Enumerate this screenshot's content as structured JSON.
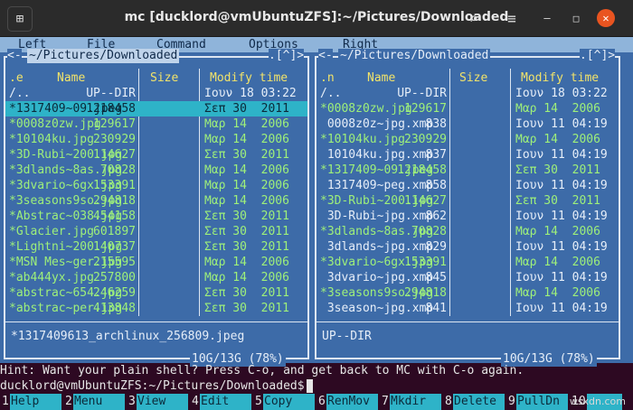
{
  "window": {
    "title": "mc [ducklord@vmUbuntuZFS]:~/Pictures/Downloaded",
    "controls": {
      "new_tab_icon": "⊞",
      "search_icon": "⌕",
      "menu_icon": "≡",
      "minimize": "–",
      "maximize": "□",
      "close": "✕"
    }
  },
  "menubar": [
    "Left",
    "File",
    "Command",
    "Options",
    "Right"
  ],
  "left_panel": {
    "title": "~/Pictures/Downloaded",
    "nav": ".[^]>",
    "nav_left": "<-",
    "headers": {
      "name_marker": ".e",
      "name": "Name",
      "size": "Size",
      "modify": "Modify time"
    },
    "rows": [
      {
        "name": "/..",
        "size": "UP--DIR",
        "date": "Ιουν 18 03:22",
        "exe": false,
        "selected": false
      },
      {
        "name": "*1317409~09.jpeg",
        "size": "1218458",
        "date": "Σεπ 30  2011",
        "exe": true,
        "selected": true
      },
      {
        "name": "*0008z0zw.jpg",
        "size": "129617",
        "date": "Μαρ 14  2006",
        "exe": true,
        "selected": false
      },
      {
        "name": "*10104ku.jpg",
        "size": "230929",
        "date": "Μαρ 14  2006",
        "exe": true,
        "selected": false
      },
      {
        "name": "*3D-Rubi~200.jpg",
        "size": "114627",
        "date": "Σεπ 30  2011",
        "exe": true,
        "selected": false
      },
      {
        "name": "*3dlands~8as.jpg",
        "size": "70828",
        "date": "Μαρ 14  2006",
        "exe": true,
        "selected": false
      },
      {
        "name": "*3dvario~6gx.jpg",
        "size": "153391",
        "date": "Μαρ 14  2006",
        "exe": true,
        "selected": false
      },
      {
        "name": "*3seasons9so.jpg",
        "size": "294818",
        "date": "Μαρ 14  2006",
        "exe": true,
        "selected": false
      },
      {
        "name": "*Abstrac~038.jpg",
        "size": "454158",
        "date": "Σεπ 30  2011",
        "exe": true,
        "selected": false
      },
      {
        "name": "*Glacier.jpg",
        "size": "601897",
        "date": "Σεπ 30  2011",
        "exe": true,
        "selected": false
      },
      {
        "name": "*Lightni~200.jpg",
        "size": "140737",
        "date": "Σεπ 30  2011",
        "exe": true,
        "selected": false
      },
      {
        "name": "*MSN Mes~ger.jpg",
        "size": "215595",
        "date": "Μαρ 14  2006",
        "exe": true,
        "selected": false
      },
      {
        "name": "*ab444yx.jpg",
        "size": "257800",
        "date": "Μαρ 14  2006",
        "exe": true,
        "selected": false
      },
      {
        "name": "*abstrac~654.jpg",
        "size": "246259",
        "date": "Σεπ 30  2011",
        "exe": true,
        "selected": false
      },
      {
        "name": "*abstrac~per.jpg",
        "size": "413848",
        "date": "Σεπ 30  2011",
        "exe": true,
        "selected": false
      }
    ],
    "status": "*1317409613_archlinux_256809.jpeg",
    "usage": "10G/13G (78%)"
  },
  "right_panel": {
    "title": "~/Pictures/Downloaded",
    "nav": ".[^]>",
    "nav_left": "<-",
    "headers": {
      "name_marker": ".n",
      "name": "Name",
      "size": "Size",
      "modify": "Modify time"
    },
    "rows": [
      {
        "name": "/..",
        "size": "UP--DIR",
        "date": "Ιουν 18 03:22",
        "exe": false
      },
      {
        "name": "*0008z0zw.jpg",
        "size": "129617",
        "date": "Μαρ 14  2006",
        "exe": true
      },
      {
        "name": " 0008z0z~jpg.xmp",
        "size": "838",
        "date": "Ιουν 11 04:19",
        "exe": false
      },
      {
        "name": "*10104ku.jpg",
        "size": "230929",
        "date": "Μαρ 14  2006",
        "exe": true
      },
      {
        "name": " 10104ku.jpg.xmp",
        "size": "837",
        "date": "Ιουν 11 04:19",
        "exe": false
      },
      {
        "name": "*1317409~09.jpeg",
        "size": "1218458",
        "date": "Σεπ 30  2011",
        "exe": true
      },
      {
        "name": " 1317409~peg.xmp",
        "size": "858",
        "date": "Ιουν 11 04:19",
        "exe": false
      },
      {
        "name": "*3D-Rubi~200.jpg",
        "size": "114627",
        "date": "Σεπ 30  2011",
        "exe": true
      },
      {
        "name": " 3D-Rubi~jpg.xmp",
        "size": "862",
        "date": "Ιουν 11 04:19",
        "exe": false
      },
      {
        "name": "*3dlands~8as.jpg",
        "size": "70828",
        "date": "Μαρ 14  2006",
        "exe": true
      },
      {
        "name": " 3dlands~jpg.xmp",
        "size": "829",
        "date": "Ιουν 11 04:19",
        "exe": false
      },
      {
        "name": "*3dvario~6gx.jpg",
        "size": "153391",
        "date": "Μαρ 14  2006",
        "exe": true
      },
      {
        "name": " 3dvario~jpg.xmp",
        "size": "845",
        "date": "Ιουν 11 04:19",
        "exe": false
      },
      {
        "name": "*3seasons9so.jpg",
        "size": "294818",
        "date": "Μαρ 14  2006",
        "exe": true
      },
      {
        "name": " 3season~jpg.xmp",
        "size": "841",
        "date": "Ιουν 11 04:19",
        "exe": false
      }
    ],
    "status": "UP--DIR",
    "usage": "10G/13G (78%)"
  },
  "hint": "Hint: Want your plain shell? Press C-o, and get back to MC with C-o again.",
  "prompt": "ducklord@vmUbuntuZFS:~/Pictures/Downloaded$",
  "fkeys": [
    {
      "num": "1",
      "label": "Help"
    },
    {
      "num": "2",
      "label": "Menu"
    },
    {
      "num": "3",
      "label": "View"
    },
    {
      "num": "4",
      "label": "Edit"
    },
    {
      "num": "5",
      "label": "Copy"
    },
    {
      "num": "6",
      "label": "RenMov"
    },
    {
      "num": "7",
      "label": "Mkdir"
    },
    {
      "num": "8",
      "label": "Delete"
    },
    {
      "num": "9",
      "label": "PullDn"
    },
    {
      "num": "10",
      "label": ""
    }
  ],
  "watermark": "wsxdn.com"
}
